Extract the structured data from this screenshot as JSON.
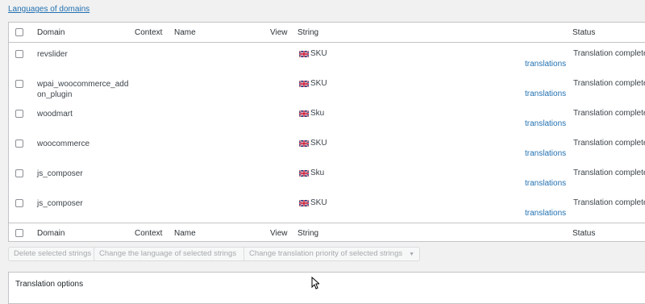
{
  "top_link": "Languages of domains",
  "columns": {
    "domain": "Domain",
    "context": "Context",
    "name": "Name",
    "view": "View",
    "string": "String",
    "status": "Status"
  },
  "rows": [
    {
      "domain": "revslider",
      "string": "SKU",
      "link": "translations",
      "status": "Translation complete"
    },
    {
      "domain": "wpai_woocommerce_addon_plugin",
      "string": "SKU",
      "link": "translations",
      "status": "Translation complete"
    },
    {
      "domain": "woodmart",
      "string": "Sku",
      "link": "translations",
      "status": "Translation complete"
    },
    {
      "domain": "woocommerce",
      "string": "SKU",
      "link": "translations",
      "status": "Translation complete"
    },
    {
      "domain": "js_composer",
      "string": "Sku",
      "link": "translations",
      "status": "Translation complete"
    },
    {
      "domain": "js_composer",
      "string": "SKU",
      "link": "translations",
      "status": "Translation complete"
    }
  ],
  "bulk_actions": {
    "delete": "Delete selected strings",
    "change_language": "Change the language of selected strings",
    "change_priority": "Change translation priority of selected strings"
  },
  "options_title": "Translation options",
  "colors": {
    "link": "#2271b1",
    "border": "#c3c4c7",
    "background": "#f1f1f1"
  },
  "icons": {
    "flag": "uk-flag-icon",
    "cursor": "mouse-cursor-icon"
  }
}
